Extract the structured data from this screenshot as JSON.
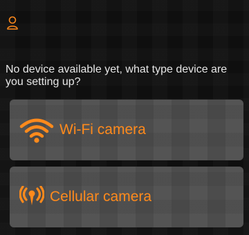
{
  "colors": {
    "accent": "#ff8a1c",
    "card_bg": "#4a4a4a",
    "page_bg": "#0f0f0f",
    "text": "#e6e6e6"
  },
  "header": {
    "profile_icon": "person-icon"
  },
  "main": {
    "prompt": "No device available yet, what type device are you setting up?",
    "options": [
      {
        "label": "Wi-Fi camera",
        "icon": "wifi-icon"
      },
      {
        "label": "Cellular camera",
        "icon": "cellular-signal-icon"
      }
    ]
  }
}
